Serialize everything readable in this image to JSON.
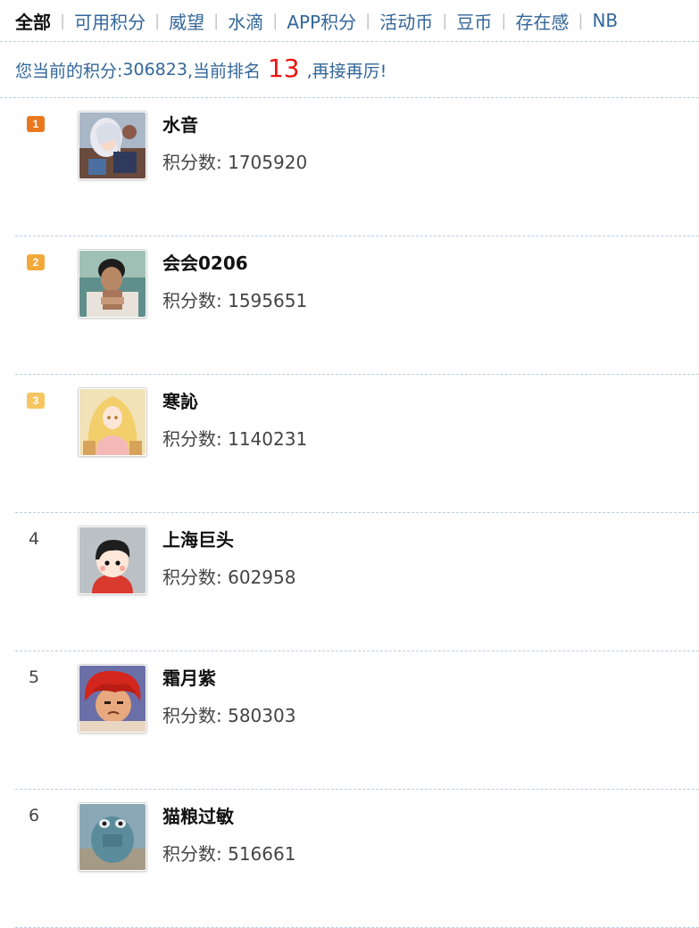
{
  "tabs": [
    {
      "label": "全部",
      "active": true
    },
    {
      "label": "可用积分"
    },
    {
      "label": "威望"
    },
    {
      "label": "水滴"
    },
    {
      "label": "APP积分"
    },
    {
      "label": "活动币"
    },
    {
      "label": "豆币"
    },
    {
      "label": "存在感"
    },
    {
      "label": "NB"
    }
  ],
  "summary": {
    "prefix": "您当前的积分: ",
    "score": "306823",
    "middle": " ,当前排名 ",
    "rank": "13",
    "suffix": " ,再接再厉!"
  },
  "score_label": "积分数: ",
  "rows": [
    {
      "rank": "1",
      "name": "水音",
      "score": "1705920",
      "avatar": "anime-girl-avatar"
    },
    {
      "rank": "2",
      "name": "会会0206",
      "score": "1595651",
      "avatar": "man-photo-avatar"
    },
    {
      "rank": "3",
      "name": "寒訫",
      "score": "1140231",
      "avatar": "blonde-anime-avatar"
    },
    {
      "rank": "4",
      "name": "上海巨头",
      "score": "602958",
      "avatar": "cartoon-boy-avatar"
    },
    {
      "rank": "5",
      "name": "霜月紫",
      "score": "580303",
      "avatar": "redhair-anime-avatar"
    },
    {
      "rank": "6",
      "name": "猫粮过敏",
      "score": "516661",
      "avatar": "blue-monster-avatar"
    }
  ],
  "colors": {
    "link": "#336699",
    "rank_highlight": "#ee1111",
    "badge_gold": "#e8791f",
    "badge_orange": "#f2a93a",
    "badge_yellow": "#f6c55f"
  }
}
